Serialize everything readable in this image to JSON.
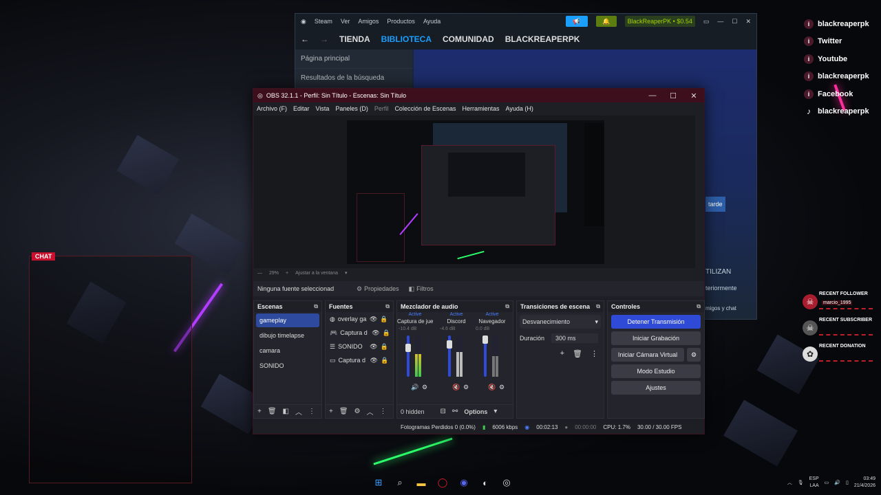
{
  "social": [
    {
      "label": "blackreaperpk",
      "icon": "blackreaperpk-icon"
    },
    {
      "label": "Twitter",
      "icon": "twitter-icon"
    },
    {
      "label": "Youtube",
      "icon": "youtube-icon"
    },
    {
      "label": "blackreaperpk",
      "icon": "blackreaperpk-icon"
    },
    {
      "label": "Facebook",
      "icon": "facebook-icon"
    },
    {
      "label": "blackreaperpk",
      "icon": "tiktok-icon"
    }
  ],
  "alerts": [
    {
      "title": "RECENT FOLLOWER",
      "name": "marcio_1995"
    },
    {
      "title": "RECENT SUBSCRIBER",
      "name": ""
    },
    {
      "title": "RECENT DONATION",
      "name": ""
    }
  ],
  "chat": {
    "label": "CHAT"
  },
  "steam": {
    "top_items": [
      "Steam",
      "Ver",
      "Amigos",
      "Productos",
      "Ayuda"
    ],
    "user_button": "BlackReaperPK • $0.54",
    "nav": [
      "TIENDA",
      "BIBLIOTECA",
      "COMUNIDAD",
      "BLACKREAPERPK"
    ],
    "active_nav": "BIBLIOTECA",
    "left_rows": [
      "Página principal",
      "Resultados de la búsqueda"
    ],
    "right_texts": [
      "tarde",
      "TILIZAN",
      "teriormente",
      "migos y chat"
    ]
  },
  "obs": {
    "title": "OBS 32.1.1 - Perfil: Sin Título - Escenas: Sin Título",
    "menu": [
      "Archivo (F)",
      "Editar",
      "Vista",
      "Paneles (D)",
      "Perfil",
      "Colección de Escenas",
      "Herramientas",
      "Ayuda (H)"
    ],
    "zoom": "29%",
    "zoom_fit": "Ajustar a la ventana",
    "no_source": "Ninguna fuente seleccionad",
    "properties": "Propiedades",
    "filters": "Filtros",
    "docks": {
      "scenes": "Escenas",
      "sources": "Fuentes",
      "mixer": "Mezclador de audio",
      "transitions": "Transiciones de escena",
      "controls": "Controles"
    },
    "scenes": [
      "gameplay",
      "dibujo timelapse",
      "camara",
      "SONIDO"
    ],
    "selected_scene": "gameplay",
    "sources": [
      {
        "name": "overlay ga",
        "icon": "browser-icon"
      },
      {
        "name": "Captura d",
        "icon": "gamepad-icon"
      },
      {
        "name": "SONIDO",
        "icon": "list-icon"
      },
      {
        "name": "Captura d",
        "icon": "monitor-icon"
      }
    ],
    "mixer": [
      {
        "status": "Active",
        "name": "Captura de juego",
        "db": "-10.4 dB",
        "level": 0.55,
        "gain": 0.75
      },
      {
        "status": "Active",
        "name": "Discord",
        "db": "-4.6 dB",
        "level": 0.6,
        "gain": 0.85
      },
      {
        "status": "Active",
        "name": "Navegador",
        "db": "0.0 dB",
        "level": 0.5,
        "gain": 1.0
      }
    ],
    "mixer_ticks": [
      "-6",
      "-12",
      "-18",
      "-24",
      "-30",
      "-36",
      "-42",
      "-48",
      "-54",
      "-60"
    ],
    "mixer_footer": {
      "hidden": "0 hidden",
      "options": "Options"
    },
    "transition": {
      "type": "Desvanecimiento",
      "duration_label": "Duración",
      "duration": "300 ms"
    },
    "controls": [
      "Detener Transmisión",
      "Iniciar Grabación",
      "Iniciar Cámara Virtual",
      "Modo Estudio",
      "Ajustes"
    ],
    "status": {
      "dropped": "Fotogramas Perdidos 0 (0.0%)",
      "bitrate": "6006 kbps",
      "stream_time": "00:02:13",
      "rec_time": "00:00:00",
      "cpu": "CPU: 1.7%",
      "fps": "30.00 / 30.00 FPS"
    }
  },
  "taskbar": {
    "lang": "ESP",
    "region": "LAA",
    "time": "03:49",
    "date": "21/4/2026"
  },
  "colors": {
    "accent": "#2e4ad6",
    "obs_title": "#3d0f1c",
    "steam_blue": "#1a9fff"
  }
}
